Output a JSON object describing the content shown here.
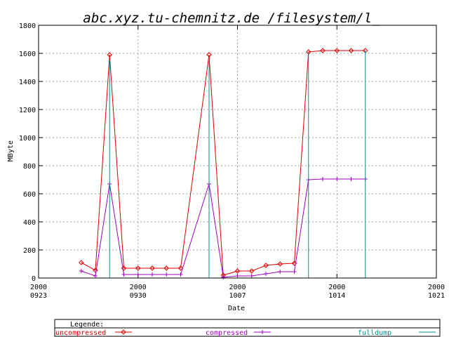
{
  "chart_data": {
    "type": "line",
    "title": "abc.xyz.tu-chemnitz.de  /filesystem/l_",
    "xlabel": "Date",
    "ylabel": "MByte",
    "x_tick_labels": [
      [
        "2000",
        "0923"
      ],
      [
        "2000",
        "0930"
      ],
      [
        "2000",
        "1007"
      ],
      [
        "2000",
        "1014"
      ],
      [
        "2000",
        "1021"
      ]
    ],
    "xlim": [
      0,
      28
    ],
    "ylim": [
      0,
      1800
    ],
    "y_ticks": [
      0,
      200,
      400,
      600,
      800,
      1000,
      1200,
      1400,
      1600,
      1800
    ],
    "grid": true,
    "legend_title": "Legende:",
    "legend_position": "bottom",
    "series": [
      {
        "name": "uncompressed",
        "color": "#e00000",
        "marker": "diamond",
        "points": [
          [
            3,
            110
          ],
          [
            4,
            55
          ],
          [
            5,
            1590
          ],
          [
            6,
            70
          ],
          [
            7,
            70
          ],
          [
            8,
            70
          ],
          [
            9,
            70
          ],
          [
            10,
            70
          ],
          [
            12,
            1590
          ],
          [
            13,
            20
          ],
          [
            14,
            50
          ],
          [
            15,
            50
          ],
          [
            16,
            90
          ],
          [
            17,
            100
          ],
          [
            18,
            105
          ],
          [
            19,
            1610
          ],
          [
            20,
            1620
          ],
          [
            21,
            1620
          ],
          [
            22,
            1620
          ],
          [
            23,
            1620
          ]
        ]
      },
      {
        "name": "compressed",
        "color": "#a000c0",
        "marker": "plus",
        "points": [
          [
            3,
            50
          ],
          [
            4,
            15
          ],
          [
            5,
            670
          ],
          [
            6,
            25
          ],
          [
            7,
            25
          ],
          [
            8,
            25
          ],
          [
            9,
            25
          ],
          [
            10,
            25
          ],
          [
            12,
            670
          ],
          [
            13,
            5
          ],
          [
            14,
            15
          ],
          [
            15,
            15
          ],
          [
            16,
            30
          ],
          [
            17,
            45
          ],
          [
            18,
            45
          ],
          [
            19,
            700
          ],
          [
            20,
            705
          ],
          [
            21,
            705
          ],
          [
            22,
            705
          ],
          [
            23,
            705
          ]
        ]
      },
      {
        "name": "fulldump",
        "color": "#009090",
        "style": "impulse",
        "points": [
          [
            5,
            1550
          ],
          [
            12,
            1550
          ],
          [
            19,
            1610
          ],
          [
            23,
            1620
          ]
        ]
      }
    ]
  }
}
